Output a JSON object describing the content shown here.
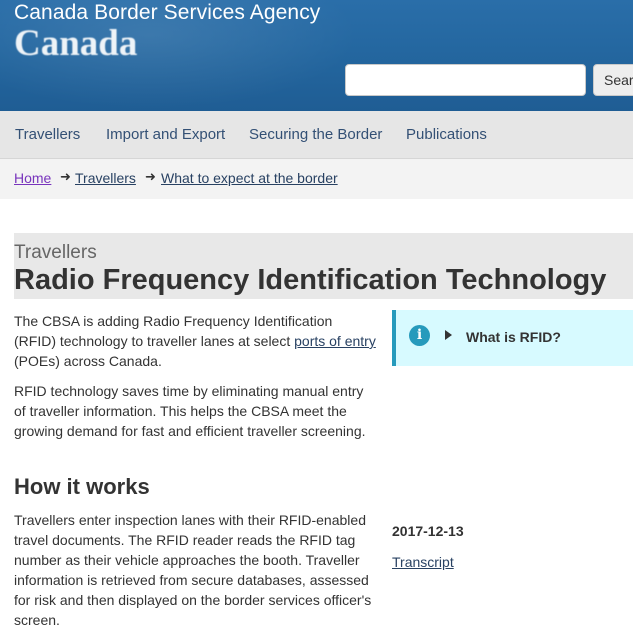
{
  "header": {
    "agency_name": "Canada Border Services Agency",
    "wordmark": "Canada",
    "search": {
      "placeholder": "",
      "button_label": "Search"
    }
  },
  "menu": {
    "items": [
      {
        "label": "Travellers"
      },
      {
        "label": "Import and Export"
      },
      {
        "label": "Securing the Border"
      },
      {
        "label": "Publications"
      }
    ]
  },
  "breadcrumb": {
    "separator": "➜",
    "items": [
      {
        "label": "Home"
      },
      {
        "label": "Travellers"
      },
      {
        "label": "What to expect at the border"
      }
    ]
  },
  "page": {
    "section_kicker": "Travellers",
    "title": "Radio Frequency Identification Technology",
    "intro": {
      "before_link": "The CBSA is adding Radio Frequency Identification (RFID) technology to traveller lanes at select ",
      "link_text": "ports of entry",
      "after_link": " (POEs) across Canada."
    },
    "paragraph_2": "RFID technology saves time by eliminating manual entry of traveller information. This helps the CBSA meet the growing demand for fast and efficient traveller screening.",
    "how_it_works": {
      "heading": "How it works",
      "text": "Travellers enter inspection lanes with their RFID-enabled travel documents. The RFID reader reads the RFID tag number as their vehicle approaches the booth. Traveller information is retrieved from secure databases, assessed for risk and then displayed on the border services officer's screen."
    }
  },
  "sidebar": {
    "info_box": {
      "icon": "info-icon",
      "summary": "What is RFID?",
      "accent": "#269abc",
      "background": "#d7faff"
    },
    "video": {
      "date": "2017-12-13",
      "transcript_label": "Transcript"
    }
  },
  "colors": {
    "header_blue": "#2467a0",
    "link": "#284162",
    "visited_link": "#7834bc",
    "menu_background": "#e6e6e6",
    "title_band": "#e8e8e8"
  }
}
